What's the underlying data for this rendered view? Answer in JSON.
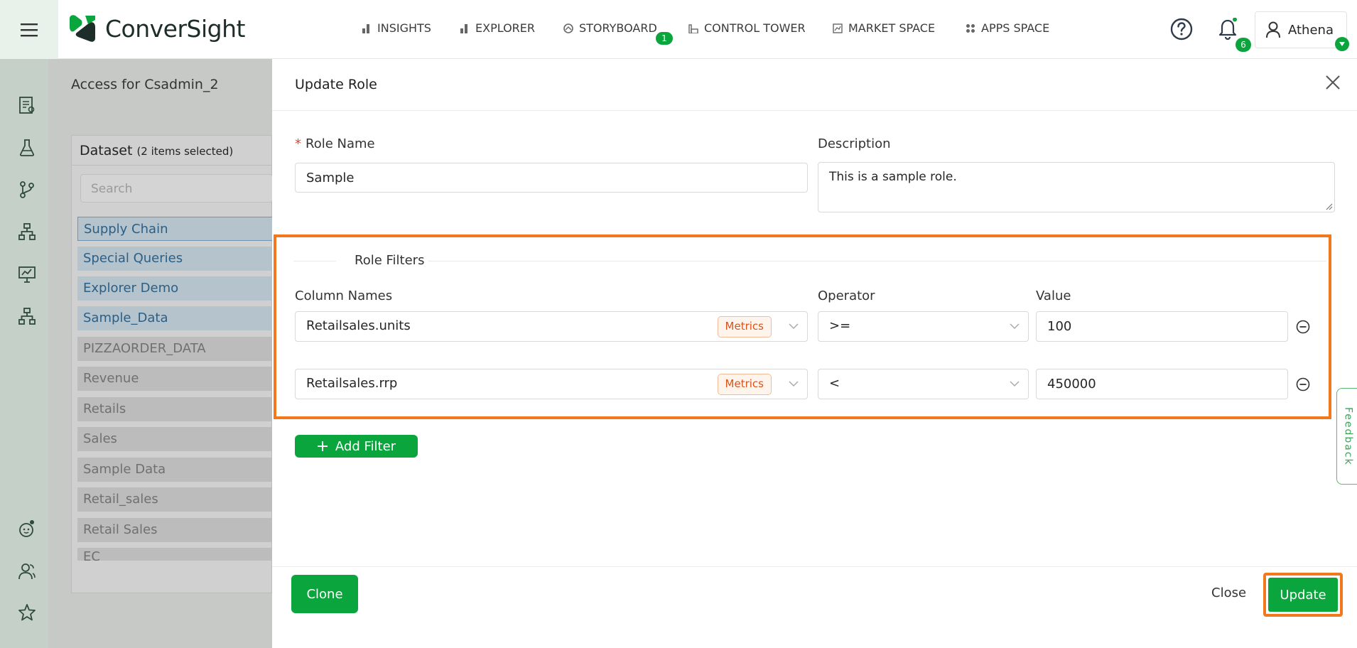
{
  "app": {
    "brand": "ConverSight",
    "nav": [
      {
        "label": "INSIGHTS",
        "icon": "bar-chart-icon"
      },
      {
        "label": "EXPLORER",
        "icon": "bar-chart-icon"
      },
      {
        "label": "STORYBOARD",
        "icon": "storyboard-icon",
        "badge": "1"
      },
      {
        "label": "CONTROL TOWER",
        "icon": "control-tower-icon"
      },
      {
        "label": "MARKET SPACE",
        "icon": "market-space-icon"
      },
      {
        "label": "APPS SPACE",
        "icon": "apps-grid-icon"
      }
    ],
    "notifications_count": "6",
    "user_name": "Athena",
    "accent_color": "#0aa53c",
    "highlight_color": "#f2781e"
  },
  "sidebar": {
    "icons": [
      "report-icon",
      "flask-icon",
      "branch-icon",
      "hierarchy-icon",
      "presentation-icon",
      "hierarchy-icon",
      "bot-icon",
      "user-group-icon",
      "star-icon"
    ]
  },
  "background_page": {
    "title": "Access for Csadmin_2",
    "dataset_label": "Dataset",
    "dataset_count": "(2 items selected)",
    "search_placeholder": "Search",
    "datasets": [
      {
        "name": "Supply Chain",
        "selected": true
      },
      {
        "name": "Special Queries",
        "selected": true
      },
      {
        "name": "Explorer Demo",
        "selected": true
      },
      {
        "name": "Sample_Data",
        "selected": true
      },
      {
        "name": "PIZZAORDER_DATA",
        "selected": false
      },
      {
        "name": "Revenue",
        "selected": false
      },
      {
        "name": "Retails",
        "selected": false
      },
      {
        "name": "Sales",
        "selected": false
      },
      {
        "name": "Sample Data",
        "selected": false
      },
      {
        "name": "Retail_sales",
        "selected": false
      },
      {
        "name": "Retail Sales",
        "selected": false
      },
      {
        "name": "EC",
        "selected": false
      }
    ]
  },
  "modal": {
    "title": "Update Role",
    "role_name_label": "Role Name",
    "role_name_value": "Sample",
    "description_label": "Description",
    "description_value": "This is a sample role.",
    "filters_title": "Role Filters",
    "col_header": "Column Names",
    "op_header": "Operator",
    "val_header": "Value",
    "filters": [
      {
        "column": "Retailsales.units",
        "tag": "Metrics",
        "operator": ">=",
        "value": "100"
      },
      {
        "column": "Retailsales.rrp",
        "tag": "Metrics",
        "operator": "<",
        "value": "450000"
      }
    ],
    "add_filter_label": "Add Filter",
    "clone_label": "Clone",
    "close_label": "Close",
    "update_label": "Update"
  },
  "feedback_label": "Feedback"
}
